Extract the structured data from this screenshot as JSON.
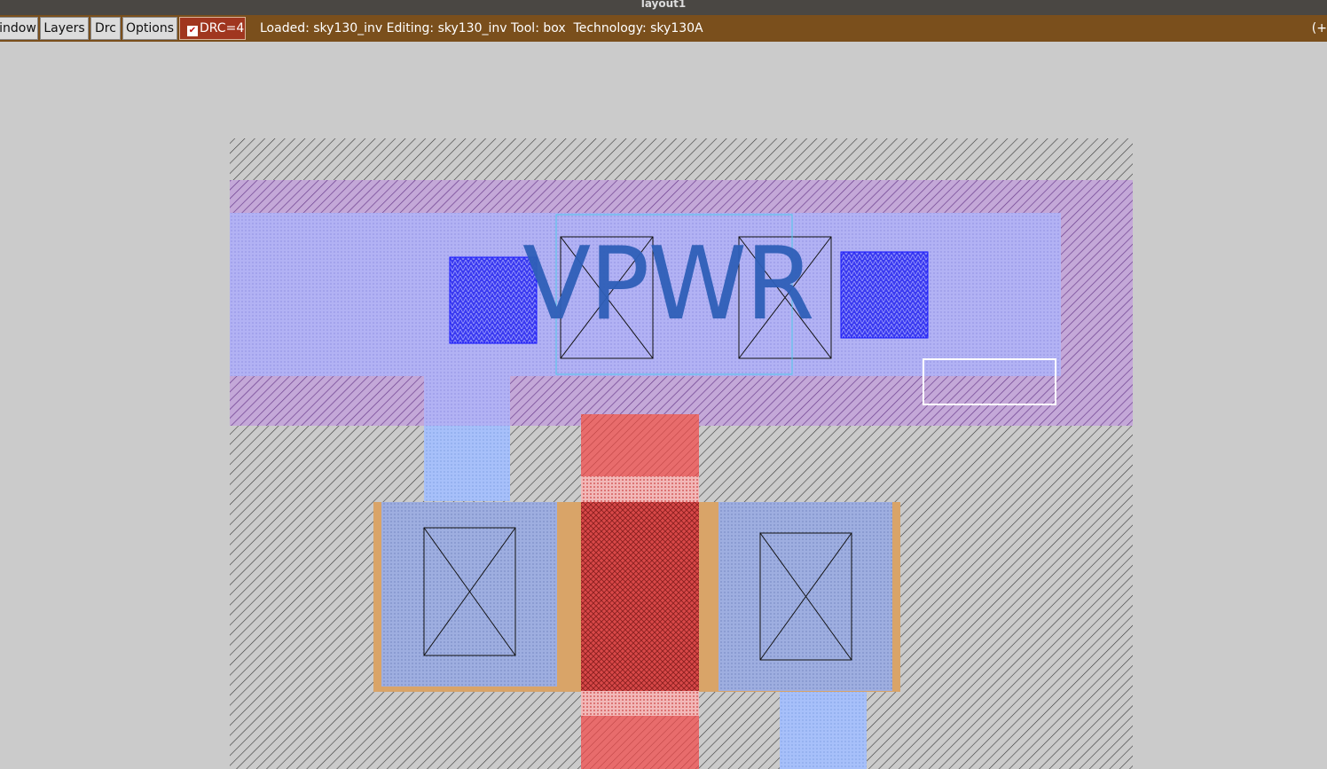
{
  "window": {
    "title": "layout1"
  },
  "menubar": {
    "items": [
      {
        "label": "indow"
      },
      {
        "label": "Layers"
      },
      {
        "label": "Drc"
      },
      {
        "label": "Options"
      }
    ],
    "drc": {
      "label": "DRC=4",
      "checked": true,
      "color": "#a0361f"
    },
    "status": "Loaded: sky130_inv Editing: sky130_inv Tool: box  Technology: sky130A",
    "status_right": "(+"
  },
  "layout": {
    "label": "VPWR",
    "colors": {
      "background": "#cbcbcb",
      "substrate_hatch": "#333333",
      "nwell": "#a87fc4",
      "metal1": "#a6a6ff",
      "poly": "#e05a5a",
      "diffusion": "#e0a060",
      "local_interconnect": "#9fb9ff",
      "mcon": "#1010ff",
      "selection_box": "#ffffff",
      "label_box": "#4fc8e8"
    }
  }
}
